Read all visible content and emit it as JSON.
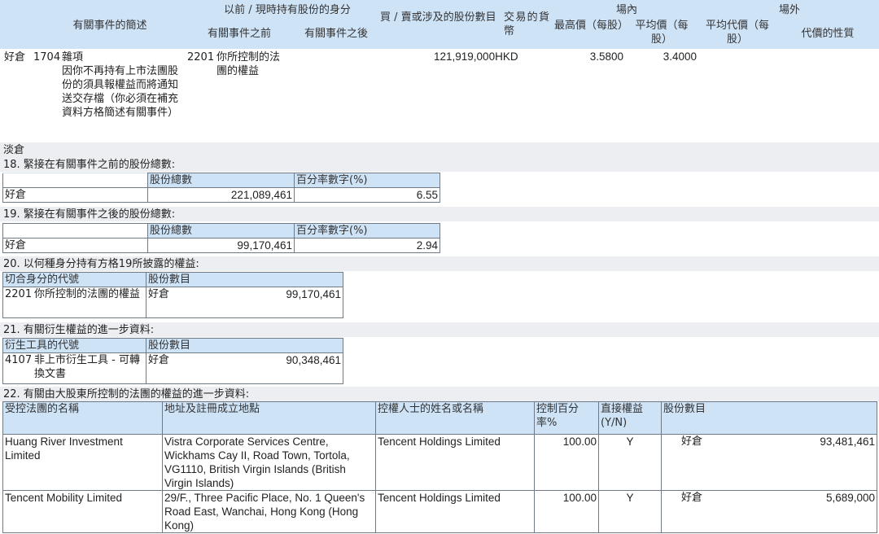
{
  "top_header": {
    "event_summary": "有關事件的簡述",
    "capacity_group": "以前 / 現時持有股份的身分",
    "capacity_before": "有關事件之前",
    "capacity_after": "有關事件之後",
    "shares_involved": "買 / 賣或涉及的股份數目",
    "currency": "交易的貨幣",
    "on_exchange": "場內",
    "highest_price": "最高價（每股）",
    "average_price": "平均價（每股）",
    "off_exchange": "場外",
    "avg_consideration": "平均代價（每股）",
    "nature_of_consideration": "代價的性質"
  },
  "event_row": {
    "position": "好倉",
    "event_code": "1704",
    "event_desc": "雜項\n因你不再持有上市法團股份的須具報權益而將通知送交存檔（你必須在補充資料方格簡述有關事件）",
    "capacity_code": "2201",
    "capacity_desc": "你所控制的法團的權益",
    "shares_currency": "121,919,000HKD",
    "highest_price": "3.5800",
    "average_price": "3.4000"
  },
  "short_label": "淡倉",
  "section18": {
    "title": "18. 緊接在有關事件之前的股份總數:",
    "col_total": "股份總數",
    "col_pct": "百分率數字(%)",
    "row_label": "好倉",
    "total": "221,089,461",
    "pct": "6.55"
  },
  "section19": {
    "title": "19. 緊接在有關事件之後的股份總數:",
    "col_total": "股份總數",
    "col_pct": "百分率數字(%)",
    "row_label": "好倉",
    "total": "99,170,461",
    "pct": "2.94"
  },
  "section20": {
    "title": "20. 以何種身分持有方格19所披露的權益:",
    "col_code": "切合身分的代號",
    "col_shares": "股份數目",
    "code": "2201",
    "desc": "你所控制的法團的權益",
    "position": "好倉",
    "shares": "99,170,461"
  },
  "section21": {
    "title": "21. 有關衍生權益的進一步資料:",
    "col_code": "衍生工具的代號",
    "col_shares": "股份數目",
    "code": "4107",
    "desc": "非上市衍生工具 - 可轉換文書",
    "position": "好倉",
    "shares": "90,348,461"
  },
  "section22": {
    "title": "22. 有關由大股東所控制的法團的權益的進一步資料:",
    "headers": {
      "corp_name": "受控法團的名稱",
      "address": "地址及註冊成立地點",
      "controller": "控權人士的姓名或名稱",
      "control_pct": "控制百分率%",
      "direct": "直接權益(Y/N)",
      "shares": "股份數目"
    },
    "rows": [
      {
        "corp_name": "Huang River Investment Limited",
        "address": "Vistra Corporate Services Centre, Wickhams Cay II, Road Town, Tortola, VG1110, British Virgin Islands (British Virgin Islands)",
        "controller": "Tencent Holdings Limited",
        "control_pct": "100.00",
        "direct": "Y",
        "position": "好倉",
        "shares": "93,481,461"
      },
      {
        "corp_name": "Tencent Mobility Limited",
        "address": "29/F., Three Pacific Place, No. 1 Queen's Road East, Wanchai, Hong Kong (Hong Kong)",
        "controller": "Tencent Holdings Limited",
        "control_pct": "100.00",
        "direct": "Y",
        "position": "好倉",
        "shares": "5,689,000"
      }
    ]
  }
}
